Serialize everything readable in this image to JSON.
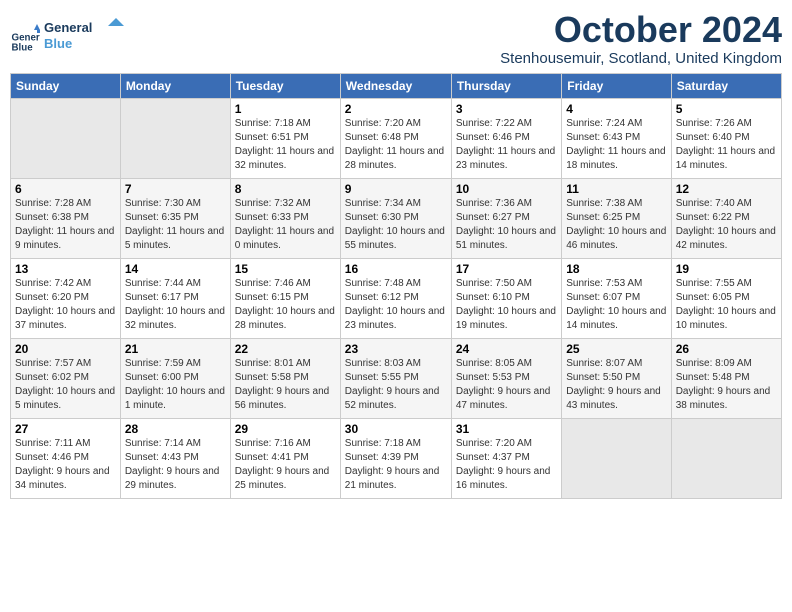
{
  "logo": {
    "text_line1": "General",
    "text_line2": "Blue"
  },
  "title": "October 2024",
  "subtitle": "Stenhousemuir, Scotland, United Kingdom",
  "weekdays": [
    "Sunday",
    "Monday",
    "Tuesday",
    "Wednesday",
    "Thursday",
    "Friday",
    "Saturday"
  ],
  "weeks": [
    [
      {
        "day": "",
        "sunrise": "",
        "sunset": "",
        "daylight": ""
      },
      {
        "day": "",
        "sunrise": "",
        "sunset": "",
        "daylight": ""
      },
      {
        "day": "1",
        "sunrise": "Sunrise: 7:18 AM",
        "sunset": "Sunset: 6:51 PM",
        "daylight": "Daylight: 11 hours and 32 minutes."
      },
      {
        "day": "2",
        "sunrise": "Sunrise: 7:20 AM",
        "sunset": "Sunset: 6:48 PM",
        "daylight": "Daylight: 11 hours and 28 minutes."
      },
      {
        "day": "3",
        "sunrise": "Sunrise: 7:22 AM",
        "sunset": "Sunset: 6:46 PM",
        "daylight": "Daylight: 11 hours and 23 minutes."
      },
      {
        "day": "4",
        "sunrise": "Sunrise: 7:24 AM",
        "sunset": "Sunset: 6:43 PM",
        "daylight": "Daylight: 11 hours and 18 minutes."
      },
      {
        "day": "5",
        "sunrise": "Sunrise: 7:26 AM",
        "sunset": "Sunset: 6:40 PM",
        "daylight": "Daylight: 11 hours and 14 minutes."
      }
    ],
    [
      {
        "day": "6",
        "sunrise": "Sunrise: 7:28 AM",
        "sunset": "Sunset: 6:38 PM",
        "daylight": "Daylight: 11 hours and 9 minutes."
      },
      {
        "day": "7",
        "sunrise": "Sunrise: 7:30 AM",
        "sunset": "Sunset: 6:35 PM",
        "daylight": "Daylight: 11 hours and 5 minutes."
      },
      {
        "day": "8",
        "sunrise": "Sunrise: 7:32 AM",
        "sunset": "Sunset: 6:33 PM",
        "daylight": "Daylight: 11 hours and 0 minutes."
      },
      {
        "day": "9",
        "sunrise": "Sunrise: 7:34 AM",
        "sunset": "Sunset: 6:30 PM",
        "daylight": "Daylight: 10 hours and 55 minutes."
      },
      {
        "day": "10",
        "sunrise": "Sunrise: 7:36 AM",
        "sunset": "Sunset: 6:27 PM",
        "daylight": "Daylight: 10 hours and 51 minutes."
      },
      {
        "day": "11",
        "sunrise": "Sunrise: 7:38 AM",
        "sunset": "Sunset: 6:25 PM",
        "daylight": "Daylight: 10 hours and 46 minutes."
      },
      {
        "day": "12",
        "sunrise": "Sunrise: 7:40 AM",
        "sunset": "Sunset: 6:22 PM",
        "daylight": "Daylight: 10 hours and 42 minutes."
      }
    ],
    [
      {
        "day": "13",
        "sunrise": "Sunrise: 7:42 AM",
        "sunset": "Sunset: 6:20 PM",
        "daylight": "Daylight: 10 hours and 37 minutes."
      },
      {
        "day": "14",
        "sunrise": "Sunrise: 7:44 AM",
        "sunset": "Sunset: 6:17 PM",
        "daylight": "Daylight: 10 hours and 32 minutes."
      },
      {
        "day": "15",
        "sunrise": "Sunrise: 7:46 AM",
        "sunset": "Sunset: 6:15 PM",
        "daylight": "Daylight: 10 hours and 28 minutes."
      },
      {
        "day": "16",
        "sunrise": "Sunrise: 7:48 AM",
        "sunset": "Sunset: 6:12 PM",
        "daylight": "Daylight: 10 hours and 23 minutes."
      },
      {
        "day": "17",
        "sunrise": "Sunrise: 7:50 AM",
        "sunset": "Sunset: 6:10 PM",
        "daylight": "Daylight: 10 hours and 19 minutes."
      },
      {
        "day": "18",
        "sunrise": "Sunrise: 7:53 AM",
        "sunset": "Sunset: 6:07 PM",
        "daylight": "Daylight: 10 hours and 14 minutes."
      },
      {
        "day": "19",
        "sunrise": "Sunrise: 7:55 AM",
        "sunset": "Sunset: 6:05 PM",
        "daylight": "Daylight: 10 hours and 10 minutes."
      }
    ],
    [
      {
        "day": "20",
        "sunrise": "Sunrise: 7:57 AM",
        "sunset": "Sunset: 6:02 PM",
        "daylight": "Daylight: 10 hours and 5 minutes."
      },
      {
        "day": "21",
        "sunrise": "Sunrise: 7:59 AM",
        "sunset": "Sunset: 6:00 PM",
        "daylight": "Daylight: 10 hours and 1 minute."
      },
      {
        "day": "22",
        "sunrise": "Sunrise: 8:01 AM",
        "sunset": "Sunset: 5:58 PM",
        "daylight": "Daylight: 9 hours and 56 minutes."
      },
      {
        "day": "23",
        "sunrise": "Sunrise: 8:03 AM",
        "sunset": "Sunset: 5:55 PM",
        "daylight": "Daylight: 9 hours and 52 minutes."
      },
      {
        "day": "24",
        "sunrise": "Sunrise: 8:05 AM",
        "sunset": "Sunset: 5:53 PM",
        "daylight": "Daylight: 9 hours and 47 minutes."
      },
      {
        "day": "25",
        "sunrise": "Sunrise: 8:07 AM",
        "sunset": "Sunset: 5:50 PM",
        "daylight": "Daylight: 9 hours and 43 minutes."
      },
      {
        "day": "26",
        "sunrise": "Sunrise: 8:09 AM",
        "sunset": "Sunset: 5:48 PM",
        "daylight": "Daylight: 9 hours and 38 minutes."
      }
    ],
    [
      {
        "day": "27",
        "sunrise": "Sunrise: 7:11 AM",
        "sunset": "Sunset: 4:46 PM",
        "daylight": "Daylight: 9 hours and 34 minutes."
      },
      {
        "day": "28",
        "sunrise": "Sunrise: 7:14 AM",
        "sunset": "Sunset: 4:43 PM",
        "daylight": "Daylight: 9 hours and 29 minutes."
      },
      {
        "day": "29",
        "sunrise": "Sunrise: 7:16 AM",
        "sunset": "Sunset: 4:41 PM",
        "daylight": "Daylight: 9 hours and 25 minutes."
      },
      {
        "day": "30",
        "sunrise": "Sunrise: 7:18 AM",
        "sunset": "Sunset: 4:39 PM",
        "daylight": "Daylight: 9 hours and 21 minutes."
      },
      {
        "day": "31",
        "sunrise": "Sunrise: 7:20 AM",
        "sunset": "Sunset: 4:37 PM",
        "daylight": "Daylight: 9 hours and 16 minutes."
      },
      {
        "day": "",
        "sunrise": "",
        "sunset": "",
        "daylight": ""
      },
      {
        "day": "",
        "sunrise": "",
        "sunset": "",
        "daylight": ""
      }
    ]
  ]
}
